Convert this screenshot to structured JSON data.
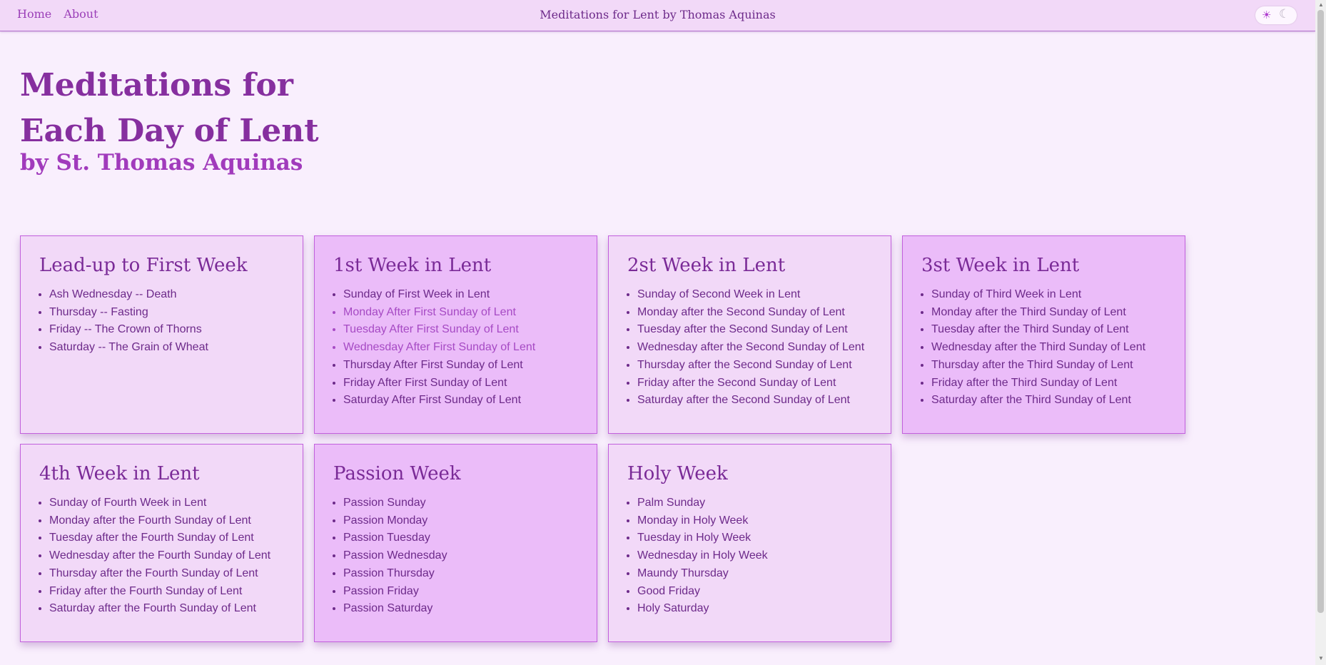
{
  "nav": {
    "home": "Home",
    "about": "About"
  },
  "site_title": "Meditations for Lent by Thomas Aquinas",
  "theme_toggle": {
    "light_icon": "sun-icon",
    "dark_icon": "moon-icon"
  },
  "hero": {
    "title": "Meditations for Each Day of Lent",
    "subtitle": "by St. Thomas Aquinas"
  },
  "colors": {
    "accent": "#862f9f",
    "card_light": "#f2d9f8",
    "card_dark": "#ebbcf9",
    "visited_link": "#a64ac4"
  },
  "cards": [
    {
      "title": "Lead-up to First Week",
      "items": [
        "Ash Wednesday -- Death",
        "Thursday -- Fasting",
        "Friday -- The Crown of Thorns",
        "Saturday -- The Grain of Wheat"
      ]
    },
    {
      "title": "1st Week in Lent",
      "items": [
        "Sunday of First Week in Lent",
        "Monday After First Sunday of Lent",
        "Tuesday After First Sunday of Lent",
        "Wednesday After First Sunday of Lent",
        "Thursday After First Sunday of Lent",
        "Friday After First Sunday of Lent",
        "Saturday After First Sunday of Lent"
      ]
    },
    {
      "title": "2st Week in Lent",
      "items": [
        "Sunday of Second Week in Lent",
        "Monday after the Second Sunday of Lent",
        "Tuesday after the Second Sunday of Lent",
        "Wednesday after the Second Sunday of Lent",
        "Thursday after the Second Sunday of Lent",
        "Friday after the Second Sunday of Lent",
        "Saturday after the Second Sunday of Lent"
      ]
    },
    {
      "title": "3st Week in Lent",
      "items": [
        "Sunday of Third Week in Lent",
        "Monday after the Third Sunday of Lent",
        "Tuesday after the Third Sunday of Lent",
        "Wednesday after the Third Sunday of Lent",
        "Thursday after the Third Sunday of Lent",
        "Friday after the Third Sunday of Lent",
        "Saturday after the Third Sunday of Lent"
      ]
    },
    {
      "title": "4th Week in Lent",
      "items": [
        "Sunday of Fourth Week in Lent",
        "Monday after the Fourth Sunday of Lent",
        "Tuesday after the Fourth Sunday of Lent",
        "Wednesday after the Fourth Sunday of Lent",
        "Thursday after the Fourth Sunday of Lent",
        "Friday after the Fourth Sunday of Lent",
        "Saturday after the Fourth Sunday of Lent"
      ]
    },
    {
      "title": "Passion Week",
      "items": [
        "Passion Sunday",
        "Passion Monday",
        "Passion Tuesday",
        "Passion Wednesday",
        "Passion Thursday",
        "Passion Friday",
        "Passion Saturday"
      ]
    },
    {
      "title": "Holy Week",
      "items": [
        "Palm Sunday",
        "Monday in Holy Week",
        "Tuesday in Holy Week",
        "Wednesday in Holy Week",
        "Maundy Thursday",
        "Good Friday",
        "Holy Saturday"
      ]
    }
  ]
}
